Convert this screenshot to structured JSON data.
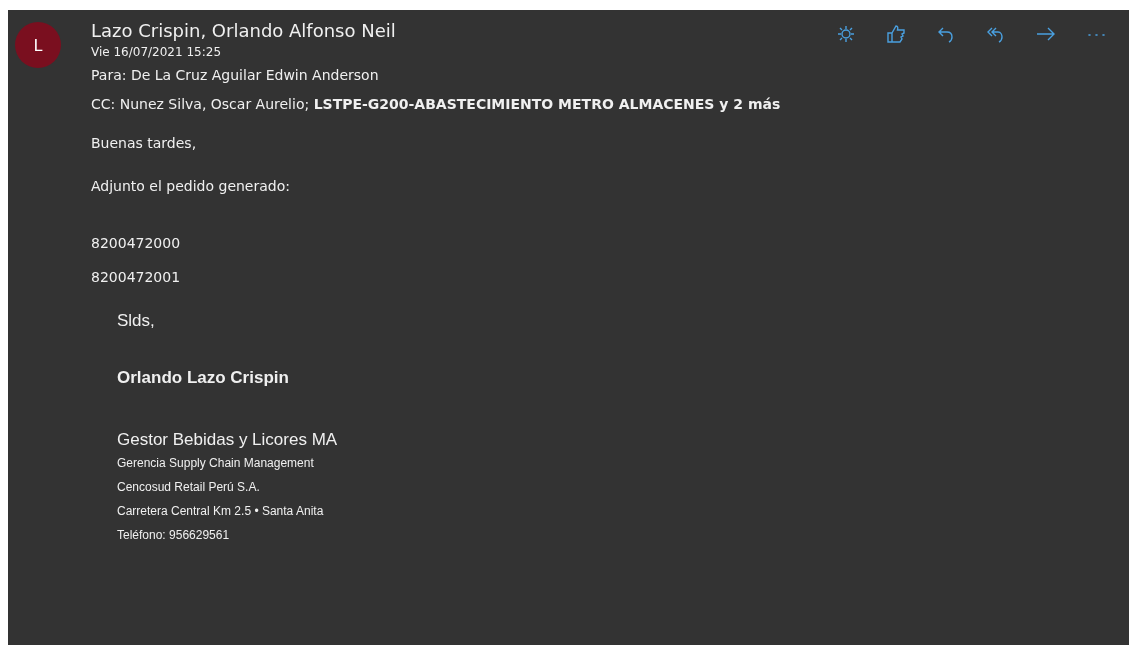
{
  "avatar": {
    "initial": "L",
    "color": "#7a0f1f"
  },
  "sender": "Lazo Crispin, Orlando Alfonso Neil",
  "date": "Vie 16/07/2021 15:25",
  "to": {
    "label": "Para:",
    "value": "De La Cruz Aguilar Edwin Anderson"
  },
  "cc": {
    "label": "CC:",
    "value": "Nunez Silva, Oscar Aurelio; **LSTPE-G200-ABASTECIMIENTO METRO ALMACENES y 2 más**"
  },
  "actions": [
    {
      "kind": "sun"
    },
    {
      "kind": "like"
    },
    {
      "kind": "reply"
    },
    {
      "kind": "reply-all"
    },
    {
      "kind": "forward"
    },
    {
      "kind": "more"
    }
  ],
  "body": [
    "Buenas tardes,",
    "Adjunto el pedido generado:"
  ],
  "orders": [
    "8200472000",
    "8200472001"
  ],
  "signature": {
    "closing": "Slds,",
    "name": "Orlando Lazo Crispin",
    "title": "Gestor Bebidas y Licores MA",
    "lines": [
      "Gerencia Supply Chain Management",
      "Cencosud Retail Perú S.A.",
      "Carretera Central Km 2.5 • Santa Anita",
      "Teléfono: 956629561"
    ]
  }
}
